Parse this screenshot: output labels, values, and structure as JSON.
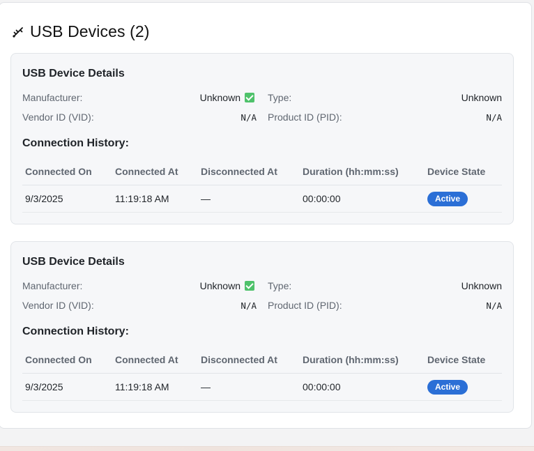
{
  "header": {
    "title": "USB Devices (2)",
    "icon": "usb-icon"
  },
  "devices": [
    {
      "title": "USB Device Details",
      "manufacturer_label": "Manufacturer:",
      "manufacturer_value": "Unknown",
      "type_label": "Type:",
      "type_value": "Unknown",
      "vid_label": "Vendor ID (VID):",
      "vid_value": "N/A",
      "pid_label": "Product ID (PID):",
      "pid_value": "N/A",
      "history_title": "Connection History:",
      "columns": [
        "Connected On",
        "Connected At",
        "Disconnected At",
        "Duration (hh:mm:ss)",
        "Device State"
      ],
      "rows": [
        {
          "connected_on": "9/3/2025",
          "connected_at": "11:19:18 AM",
          "disconnected_at": "—",
          "duration": "00:00:00",
          "state": "Active"
        }
      ]
    },
    {
      "title": "USB Device Details",
      "manufacturer_label": "Manufacturer:",
      "manufacturer_value": "Unknown",
      "type_label": "Type:",
      "type_value": "Unknown",
      "vid_label": "Vendor ID (VID):",
      "vid_value": "N/A",
      "pid_label": "Product ID (PID):",
      "pid_value": "N/A",
      "history_title": "Connection History:",
      "columns": [
        "Connected On",
        "Connected At",
        "Disconnected At",
        "Duration (hh:mm:ss)",
        "Device State"
      ],
      "rows": [
        {
          "connected_on": "9/3/2025",
          "connected_at": "11:19:18 AM",
          "disconnected_at": "—",
          "duration": "00:00:00",
          "state": "Active"
        }
      ]
    }
  ],
  "colors": {
    "badge_active": "#2b6fd6",
    "check_green": "#4fc26b",
    "card_bg": "#f6f7f9"
  }
}
